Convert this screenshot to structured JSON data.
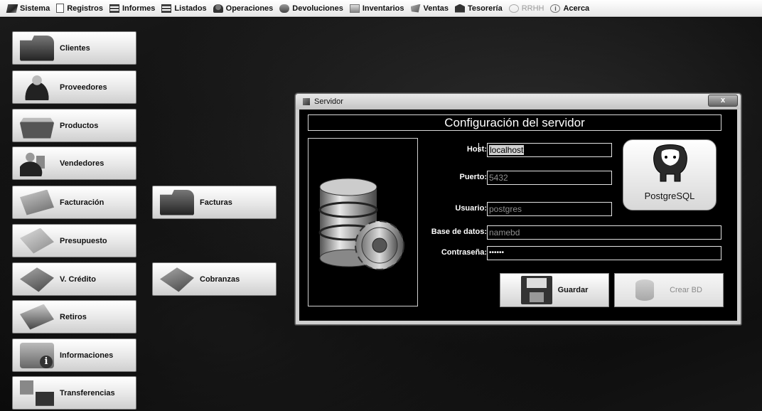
{
  "menu": [
    {
      "label": "Sistema",
      "icon": "sistema-icon",
      "enabled": true
    },
    {
      "label": "Registros",
      "icon": "registros-icon",
      "enabled": true
    },
    {
      "label": "Informes",
      "icon": "informes-icon",
      "enabled": true
    },
    {
      "label": "Listados",
      "icon": "listados-icon",
      "enabled": true
    },
    {
      "label": "Operaciones",
      "icon": "operaciones-icon",
      "enabled": true
    },
    {
      "label": "Devoluciones",
      "icon": "devoluciones-icon",
      "enabled": true
    },
    {
      "label": "Inventarios",
      "icon": "inventarios-icon",
      "enabled": true
    },
    {
      "label": "Ventas",
      "icon": "ventas-icon",
      "enabled": true
    },
    {
      "label": "Tesorería",
      "icon": "tesoreria-icon",
      "enabled": true
    },
    {
      "label": "RRHH",
      "icon": "rrhh-icon",
      "enabled": false
    },
    {
      "label": "Acerca",
      "icon": "acerca-icon",
      "enabled": true
    }
  ],
  "launcher": {
    "clientes": "Clientes",
    "proveedores": "Proveedores",
    "productos": "Productos",
    "vendedores": "Vendedores",
    "facturacion": "Facturación",
    "facturas": "Facturas",
    "presupuesto": "Presupuesto",
    "v_credito": "V. Crédito",
    "cobranzas": "Cobranzas",
    "retiros": "Retiros",
    "informaciones": "Informaciones",
    "transferencias": "Transferencias"
  },
  "dialog": {
    "title": "Servidor",
    "close_label": "x",
    "heading": "Configuración del servidor",
    "fields": {
      "host_label": "Host:",
      "host_value": "localhost",
      "puerto_label": "Puerto:",
      "puerto_value": "5432",
      "usuario_label": "Usuario:",
      "usuario_value": "postgres",
      "base_label": "Base de datos:",
      "base_value": "namebd",
      "contrasena_label": "Contraseña:",
      "contrasena_value": "••••••"
    },
    "logo_text": "PostgreSQL",
    "guardar_label": "Guardar",
    "crear_label": "Crear BD"
  }
}
